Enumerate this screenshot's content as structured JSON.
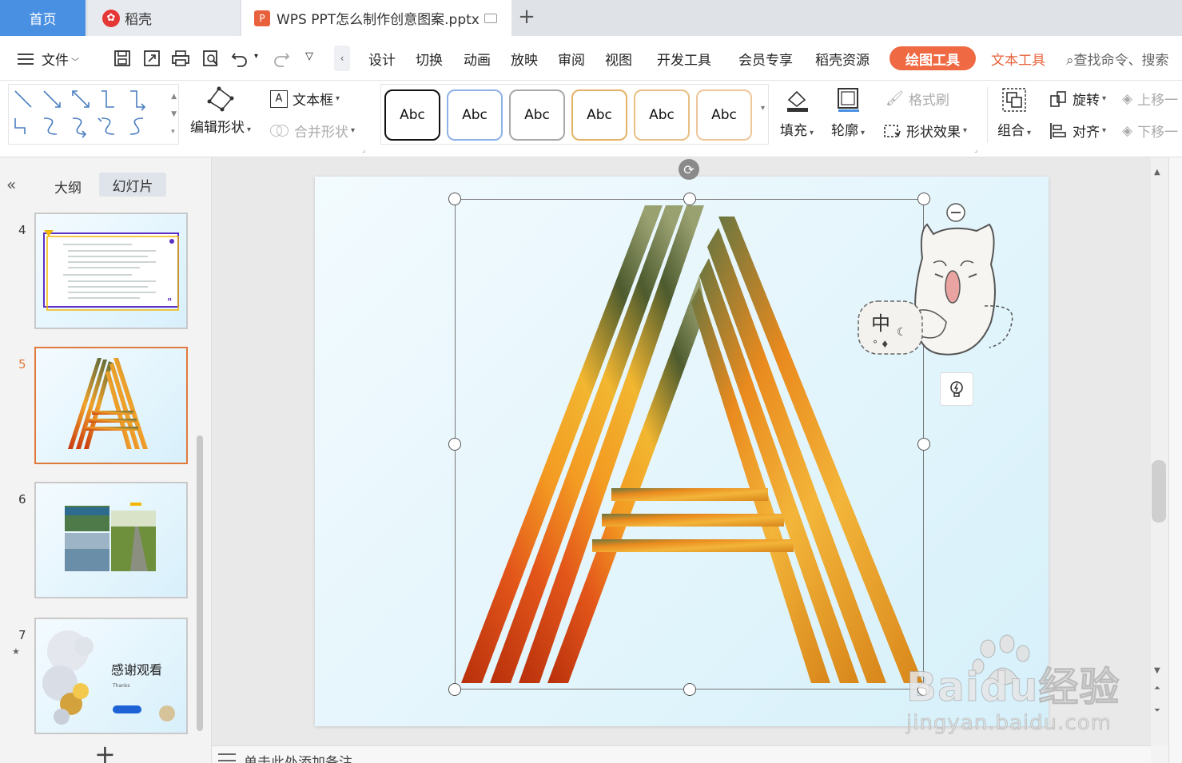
{
  "tabs": {
    "home": "首页",
    "daoke": "稻壳",
    "doc": "WPS PPT怎么制作创意图案.pptx",
    "new_tab_symbol": "+"
  },
  "menubar": {
    "file": "文件",
    "items": [
      "设计",
      "切换",
      "动画",
      "放映",
      "审阅",
      "视图",
      "开发工具",
      "会员专享",
      "稻壳资源"
    ],
    "drawing_tools": "绘图工具",
    "text_tools": "文本工具",
    "search": "查找命令、搜索"
  },
  "ribbon": {
    "edit_shape": "编辑形状",
    "text_box": "文本框",
    "merge_shape": "合并形状",
    "style_label": "Abc",
    "fill": "填充",
    "outline": "轮廓",
    "format_painter": "格式刷",
    "shape_effects": "形状效果",
    "group": "组合",
    "rotate": "旋转",
    "align": "对齐",
    "bring_forward": "上移一",
    "send_backward": "下移一"
  },
  "left_panel": {
    "outline_tab": "大纲",
    "slides_tab": "幻灯片",
    "slides": [
      {
        "number": "4"
      },
      {
        "number": "5"
      },
      {
        "number": "6"
      },
      {
        "number": "7",
        "title": "感谢观看",
        "subtitle": "Thanks"
      }
    ],
    "add_slide": "+"
  },
  "notes": {
    "placeholder": "单击此处添加备注"
  },
  "mascot": {
    "bubble_text": "中"
  },
  "watermark": {
    "brand": "Baidu经验",
    "url": "jingyan.baidu.com"
  },
  "colors": {
    "accent": "#4a90e2",
    "drawing_tab": "#ef6a43",
    "active_slide_border": "#e07a3c"
  }
}
